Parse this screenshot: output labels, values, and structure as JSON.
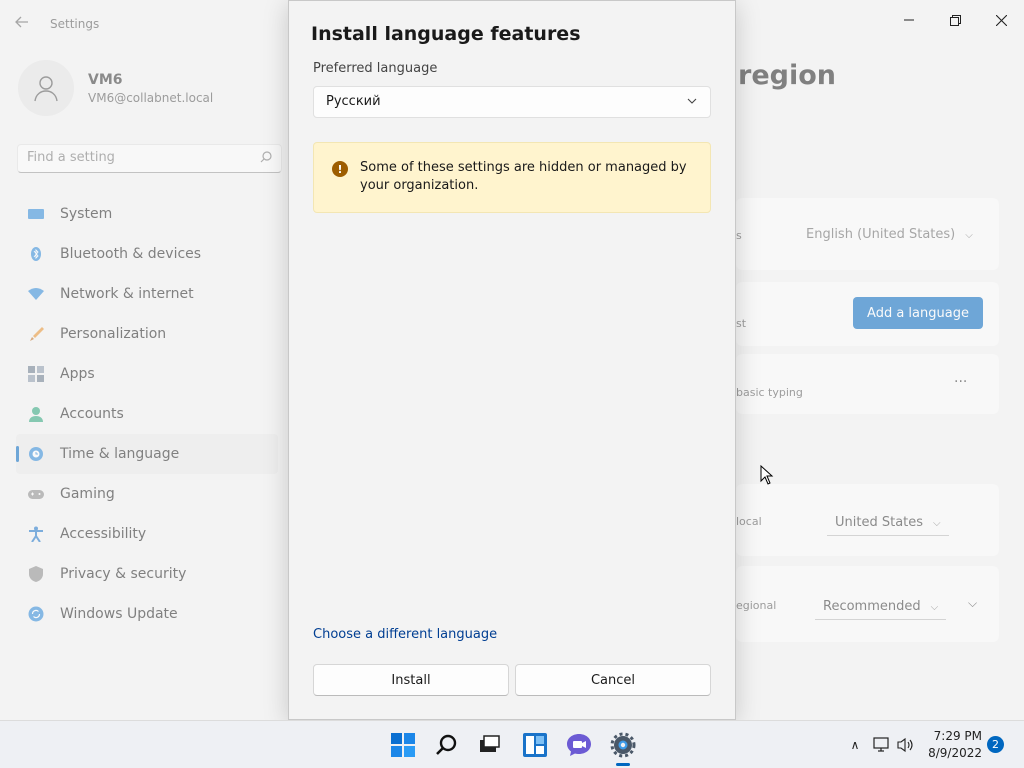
{
  "settings": {
    "app_title": "Settings",
    "window_controls": {
      "minimize": "—",
      "maximize": "❐",
      "close": "✕"
    },
    "profile": {
      "name": "VM6",
      "email": "VM6@collabnet.local"
    },
    "search": {
      "placeholder": "Find a setting"
    },
    "nav": [
      {
        "label": "System",
        "icon": "system-icon",
        "color": "#2b88d8"
      },
      {
        "label": "Bluetooth & devices",
        "icon": "bluetooth-icon",
        "color": "#2b88d8"
      },
      {
        "label": "Network & internet",
        "icon": "network-icon",
        "color": "#2b88d8"
      },
      {
        "label": "Personalization",
        "icon": "brush-icon",
        "color": "#e8912d"
      },
      {
        "label": "Apps",
        "icon": "apps-icon",
        "color": "#6b7a8c"
      },
      {
        "label": "Accounts",
        "icon": "accounts-icon",
        "color": "#2aa57a"
      },
      {
        "label": "Time & language",
        "icon": "globe-clock-icon",
        "color": "#2b88d8",
        "selected": true
      },
      {
        "label": "Gaming",
        "icon": "gamepad-icon",
        "color": "#8a8a8a"
      },
      {
        "label": "Accessibility",
        "icon": "accessibility-icon",
        "color": "#1a73c9"
      },
      {
        "label": "Privacy & security",
        "icon": "shield-icon",
        "color": "#8a8a8a"
      },
      {
        "label": "Windows Update",
        "icon": "update-icon",
        "color": "#2b88d8"
      }
    ],
    "page_heading": "region",
    "cards": {
      "display_lang_partial": "s",
      "display_lang_value": "English (United States)",
      "preferred_partial": "st",
      "add_language": "Add a language",
      "basic_typing": "basic typing",
      "more_options": "···",
      "country_partial": "local",
      "country_value": "United States",
      "regional_partial": "egional",
      "regional_value": "Recommended"
    }
  },
  "dialog": {
    "title": "Install language features",
    "preferred_language_label": "Preferred language",
    "selected_language": "Русский",
    "warning_text": "Some of these settings are hidden or managed by your organization.",
    "warning_icon_glyph": "!",
    "choose_link": "Choose a different language",
    "install_button": "Install",
    "cancel_button": "Cancel"
  },
  "taskbar": {
    "apps": [
      "start-icon",
      "search-icon",
      "task-view-icon",
      "widgets-icon",
      "chat-icon",
      "settings-gear-icon"
    ],
    "clock_time": "7:29 PM",
    "clock_date": "8/9/2022",
    "notification_count": "2",
    "tray_chevron": "∧"
  },
  "colors": {
    "accent": "#0067c0",
    "warning_bg": "#fff4ce",
    "warning_icon": "#9d5d00",
    "link": "#003e92"
  }
}
